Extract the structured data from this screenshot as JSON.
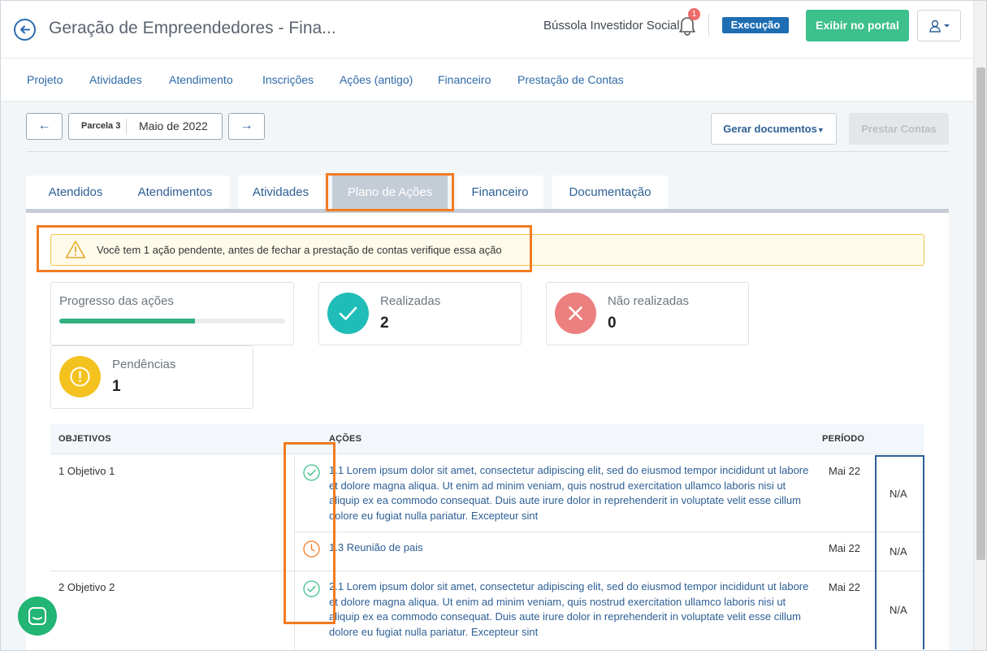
{
  "header": {
    "title": "Geração de Empreendedores - Fina...",
    "org_name": "Bússola Investidor Social",
    "notification_count": "1",
    "status_badge": "Execução",
    "portal_button": "Exibir no portal",
    "icons": [
      "back-arrow-icon",
      "bell-icon",
      "user-menu-icon",
      "chevron-down-icon"
    ]
  },
  "nav": {
    "items": [
      "Projeto",
      "Atividades",
      "Atendimento",
      "Inscrições",
      "Ações (antigo)",
      "Financeiro",
      "Prestação de Contas"
    ]
  },
  "parcel": {
    "prev_arrow": "←",
    "next_arrow": "→",
    "label": "Parcela 3",
    "value": "Maio de 2022",
    "generate_button": "Gerar documentos",
    "submit_button": "Prestar Contas"
  },
  "tabs": {
    "items": [
      "Atendidos",
      "Atendimentos",
      "Atividades",
      "Plano de Ações",
      "Financeiro",
      "Documentação"
    ],
    "active": "Plano de Ações"
  },
  "alert": {
    "text": "Você tem 1 ação pendente, antes de fechar a prestação de contas verifique essa ação"
  },
  "cards": {
    "progress": {
      "title": "Progresso das ações",
      "fraction": 0.6
    },
    "done": {
      "title": "Realizadas",
      "value": "2"
    },
    "not_done": {
      "title": "Não realizadas",
      "value": "0"
    },
    "pending": {
      "title": "Pendências",
      "value": "1"
    }
  },
  "table": {
    "headers": {
      "objectives": "OBJETIVOS",
      "actions": "AÇÕES",
      "period": "PERÍODO"
    },
    "rows": [
      {
        "objective": "1 Objetivo 1",
        "actions": [
          {
            "status": "done",
            "text": "1.1 Lorem ipsum dolor sit amet, consectetur adipiscing elit, sed do eiusmod tempor incididunt ut labore et dolore magna aliqua. Ut enim ad minim veniam, quis nostrud exercitation ullamco laboris nisi ut aliquip ex ea commodo consequat. Duis aute irure dolor in reprehenderit in voluptate velit esse cillum dolore eu fugiat nulla pariatur. Excepteur sint",
            "period": "Mai 22",
            "value": "N/A"
          },
          {
            "status": "pending",
            "text": "1.3 Reunião de pais",
            "period": "Mai 22",
            "value": "N/A"
          }
        ]
      },
      {
        "objective": "2 Objetivo 2",
        "actions": [
          {
            "status": "done",
            "text": "2.1 Lorem ipsum dolor sit amet, consectetur adipiscing elit, sed do eiusmod tempor incididunt ut labore et dolore magna aliqua. Ut enim ad minim veniam, quis nostrud exercitation ullamco laboris nisi ut aliquip ex ea commodo consequat. Duis aute irure dolor in reprehenderit in voluptate velit esse cillum dolore eu fugiat nulla pariatur. Excepteur sint",
            "period": "Mai 22",
            "value": "N/A"
          }
        ]
      }
    ]
  },
  "colors": {
    "primary": "#2d5f95",
    "success": "#3ec08c",
    "done_circle": "#1fbcb8",
    "not_done_circle": "#ec7f7f",
    "pending_circle": "#f4c21f",
    "highlight": "#f27b21"
  }
}
